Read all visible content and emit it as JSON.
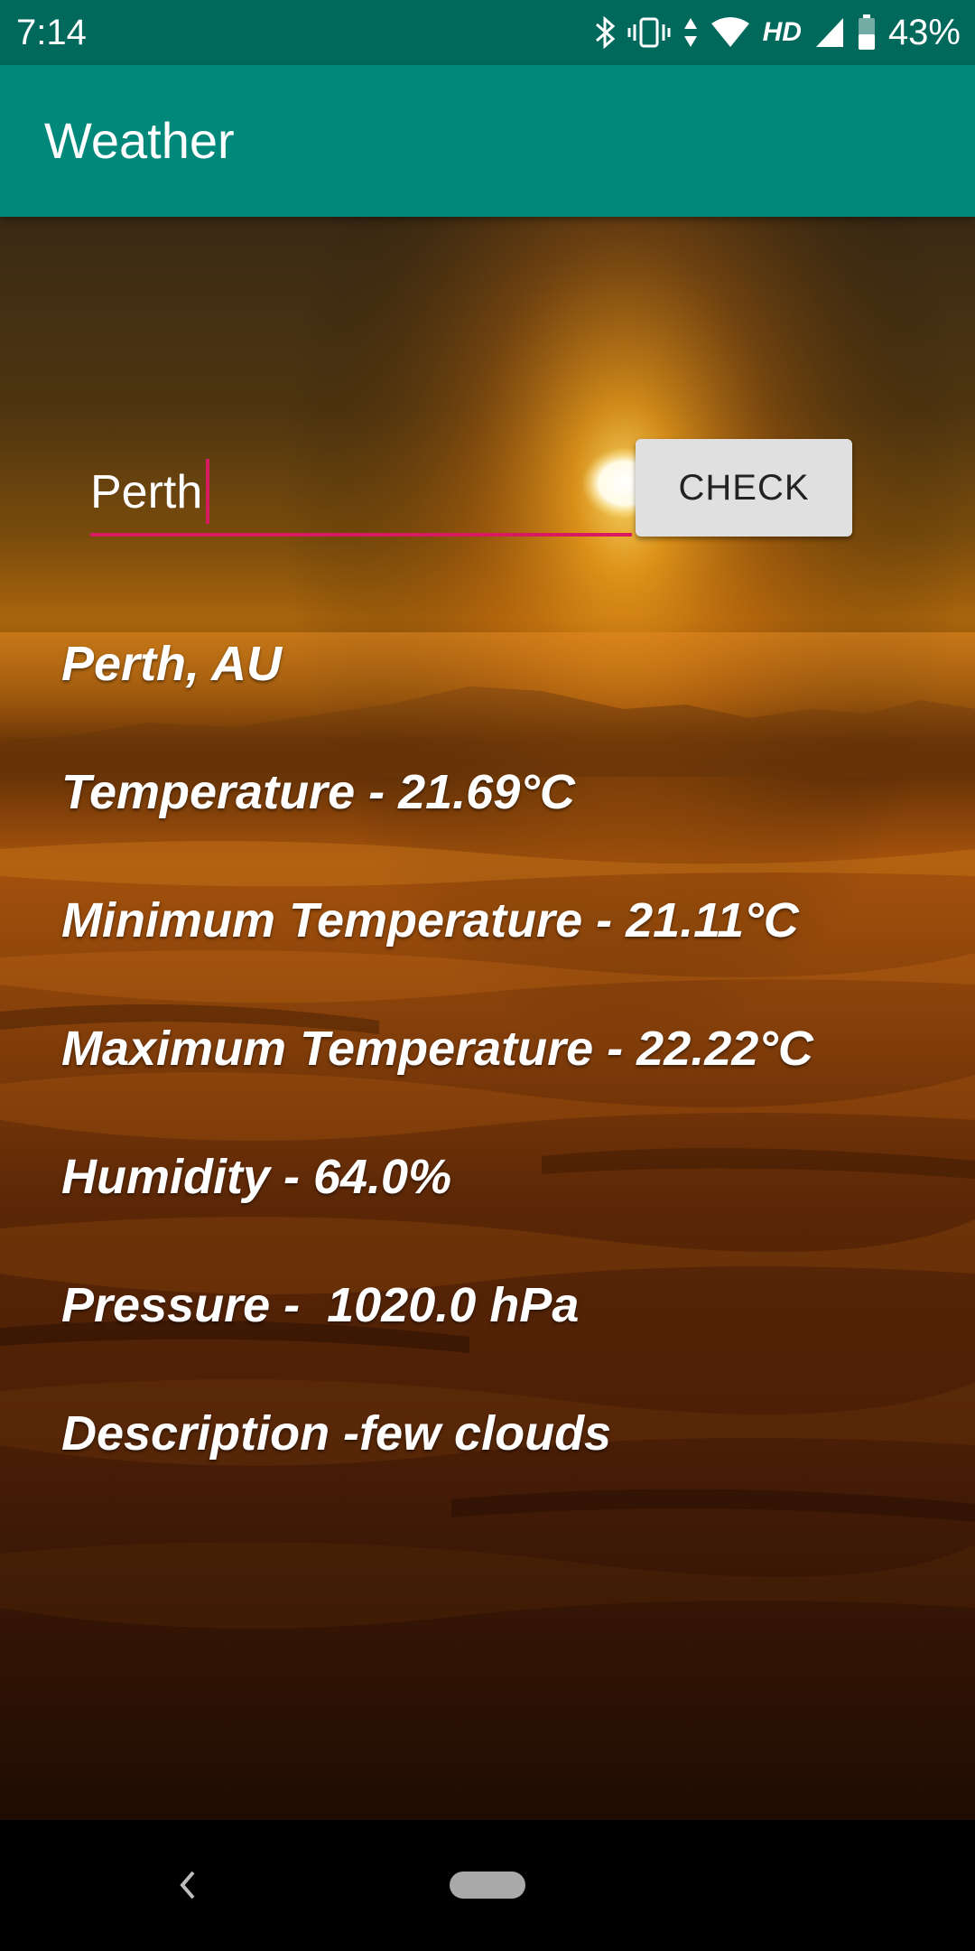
{
  "status_bar": {
    "time": "7:14",
    "network_label": "HD",
    "battery": "43%",
    "icons": [
      "bluetooth-icon",
      "vibrate-icon",
      "data-arrows-icon",
      "wifi-icon",
      "cell-signal-icon",
      "battery-icon"
    ]
  },
  "app_bar": {
    "title": "Weather"
  },
  "search": {
    "value": "Perth",
    "button_label": "CHECK"
  },
  "weather": {
    "location": "Perth, AU",
    "temperature": "Temperature - 21.69°C",
    "min_temperature": "Minimum Temperature - 21.11°C",
    "max_temperature": "Maximum Temperature - 22.22°C",
    "humidity": "Humidity - 64.0%",
    "pressure": "Pressure -  1020.0 hPa",
    "description": "Description -few clouds"
  },
  "colors": {
    "status_bar": "#00695c",
    "app_bar": "#00897b",
    "accent": "#d81b60",
    "button": "#e0e0e0"
  },
  "nav_bar": {
    "icons": [
      "back-icon",
      "home-pill-icon"
    ]
  }
}
